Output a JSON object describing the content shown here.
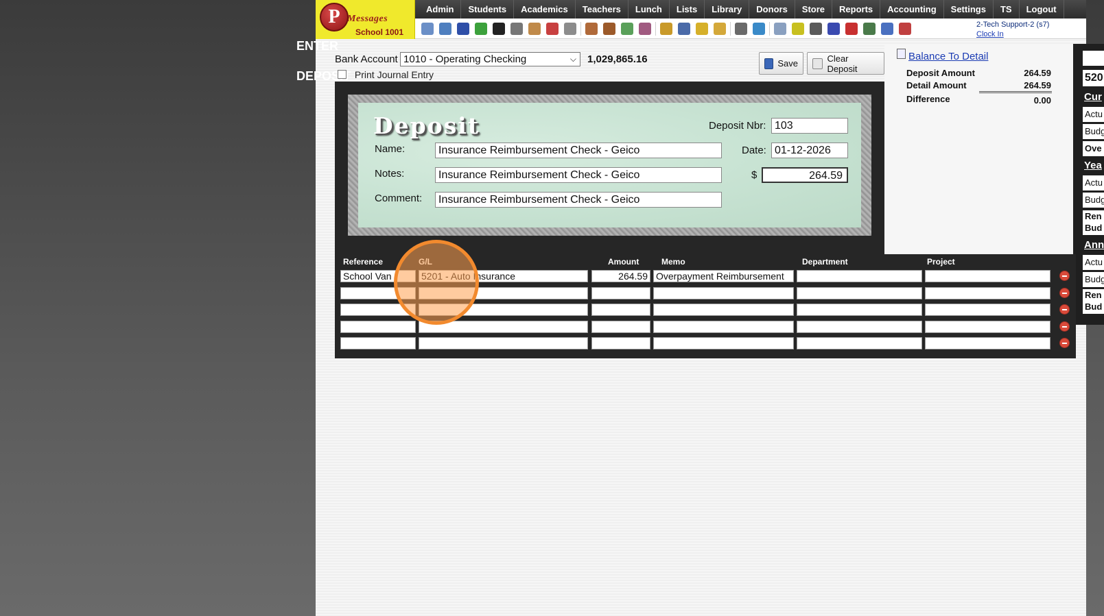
{
  "side_title": "ENTER\n\nDEPOSIT",
  "logo": {
    "initial": "P",
    "brand": "Messages",
    "school": "School 1001"
  },
  "nav": [
    "Admin",
    "Students",
    "Academics",
    "Teachers",
    "Lunch",
    "Lists",
    "Library",
    "Donors",
    "Store",
    "Reports",
    "Accounting",
    "Settings",
    "TS",
    "Logout"
  ],
  "user": {
    "name": "2-Tech Support-2 (s7)",
    "clock_in": "Clock In"
  },
  "bank": {
    "label": "Bank Account",
    "selected": "1010 - Operating Checking",
    "balance": "1,029,865.16"
  },
  "print_journal": "Print Journal Entry",
  "buttons": {
    "save": "Save",
    "clear": "Clear Deposit"
  },
  "summary": {
    "link": "Balance To Detail",
    "deposit_amount_label": "Deposit Amount",
    "deposit_amount": "264.59",
    "detail_amount_label": "Detail Amount",
    "detail_amount": "264.59",
    "difference_label": "Difference",
    "difference": "0.00"
  },
  "deposit": {
    "title": "Deposit",
    "nbr_label": "Deposit Nbr:",
    "nbr": "103",
    "name_label": "Name:",
    "name": "Insurance Reimbursement Check - Geico",
    "date_label": "Date:",
    "date": "01-12-2026",
    "notes_label": "Notes:",
    "notes": "Insurance Reimbursement Check - Geico",
    "dollar": "$",
    "amount": "264.59",
    "comment_label": "Comment:",
    "comment": "Insurance Reimbursement Check - Geico"
  },
  "grid": {
    "headers": {
      "reference": "Reference",
      "gl": "G/L",
      "amount": "Amount",
      "memo": "Memo",
      "department": "Department",
      "project": "Project"
    },
    "rows": [
      {
        "reference": "School Van",
        "gl": "5201 - Auto Insurance",
        "amount": "264.59",
        "memo": "Overpayment Reimbursement",
        "department": "",
        "project": ""
      },
      {
        "reference": "",
        "gl": "",
        "amount": "",
        "memo": "",
        "department": "",
        "project": ""
      },
      {
        "reference": "",
        "gl": "",
        "amount": "",
        "memo": "",
        "department": "",
        "project": ""
      },
      {
        "reference": "",
        "gl": "",
        "amount": "",
        "memo": "",
        "department": "",
        "project": ""
      },
      {
        "reference": "",
        "gl": "",
        "amount": "",
        "memo": "",
        "department": "",
        "project": ""
      }
    ]
  },
  "right_panel": {
    "account": "520",
    "current": "Cur",
    "actual1": "Actu",
    "budget1": "Budg",
    "over": "Ove",
    "year": "Yea",
    "actual2": "Actu",
    "budget2": "Budg",
    "remaining1a": "Ren",
    "remaining1b": "Bud",
    "annual": "Ann",
    "actual3": "Actu",
    "budget3": "Budg",
    "remaining2a": "Ren",
    "remaining2b": "Bud"
  },
  "toolbar_icons": [
    {
      "name": "search-icon",
      "color": "#6b8fc7"
    },
    {
      "name": "calendar-grid-icon",
      "color": "#4f7fbf"
    },
    {
      "name": "email-icon",
      "color": "#2f4fa8"
    },
    {
      "name": "chat-icon",
      "color": "#3ca13c"
    },
    {
      "name": "phone-icon",
      "color": "#222222"
    },
    {
      "name": "speaker-icon",
      "color": "#777777"
    },
    {
      "name": "report-card-icon",
      "color": "#c08a4a"
    },
    {
      "name": "calendar-icon",
      "color": "#c84040"
    },
    {
      "name": "megaphone-icon",
      "color": "#8c8c8c"
    },
    {
      "name": "teacher-icon",
      "color": "#b06a3a"
    },
    {
      "name": "student-icon",
      "color": "#9c5a2a"
    },
    {
      "name": "money-icon",
      "color": "#5aa05a"
    },
    {
      "name": "group-icon",
      "color": "#a05a80"
    },
    {
      "name": "lunch-icon",
      "color": "#c99a2a"
    },
    {
      "name": "book-icon",
      "color": "#4a6aa8"
    },
    {
      "name": "tag-icon",
      "color": "#d6b02a"
    },
    {
      "name": "folder-icon",
      "color": "#d4a83a"
    },
    {
      "name": "person-icon",
      "color": "#6a6a6a"
    },
    {
      "name": "clock-icon",
      "color": "#3a8ac8"
    },
    {
      "name": "list-icon",
      "color": "#8aa0c0"
    },
    {
      "name": "card-icon",
      "color": "#c8c020"
    },
    {
      "name": "printer-icon",
      "color": "#5a5a5a"
    },
    {
      "name": "ap-icon",
      "color": "#3a4ab0"
    },
    {
      "name": "pdf-icon",
      "color": "#c83030"
    },
    {
      "name": "cash-icon",
      "color": "#4a7a4a"
    },
    {
      "name": "help-icon",
      "color": "#4a70c0"
    },
    {
      "name": "power-icon",
      "color": "#c04040"
    }
  ]
}
